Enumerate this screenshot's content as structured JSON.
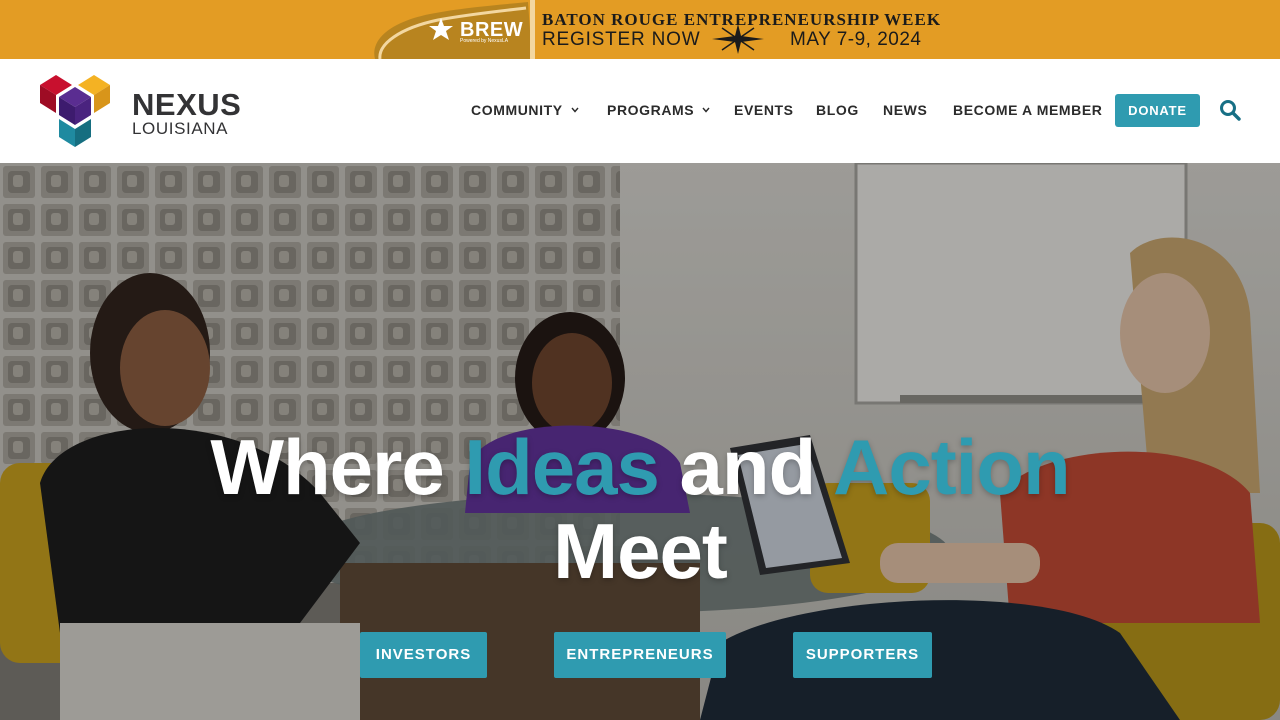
{
  "promo": {
    "brand": "BREW",
    "brand_sub": "Powered by NexusLA",
    "headline": "BATON ROUGE ENTREPRENEURSHIP WEEK",
    "register": "REGISTER NOW",
    "dates": "MAY 7-9, 2024",
    "background_color": "#e39c24"
  },
  "header": {
    "logo_word": "NEXUS",
    "logo_sub": "LOUISIANA",
    "nav": [
      {
        "label": "COMMUNITY",
        "has_dropdown": true
      },
      {
        "label": "PROGRAMS",
        "has_dropdown": true
      },
      {
        "label": "EVENTS",
        "has_dropdown": false
      },
      {
        "label": "BLOG",
        "has_dropdown": false
      },
      {
        "label": "NEWS",
        "has_dropdown": false
      },
      {
        "label": "BECOME A MEMBER",
        "has_dropdown": false
      }
    ],
    "donate_label": "DONATE",
    "search_icon": "search-icon"
  },
  "hero": {
    "headline_part1": "Where ",
    "headline_accent1": "Ideas",
    "headline_part2": " and ",
    "headline_accent2": "Action",
    "headline_line2": "Meet",
    "ctas": [
      {
        "label": "INVESTORS"
      },
      {
        "label": "ENTREPRENEURS"
      },
      {
        "label": "SUPPORTERS"
      }
    ]
  },
  "colors": {
    "accent": "#2f9bb0",
    "nav_text": "#2b2b2b",
    "promo": "#e39c24"
  }
}
